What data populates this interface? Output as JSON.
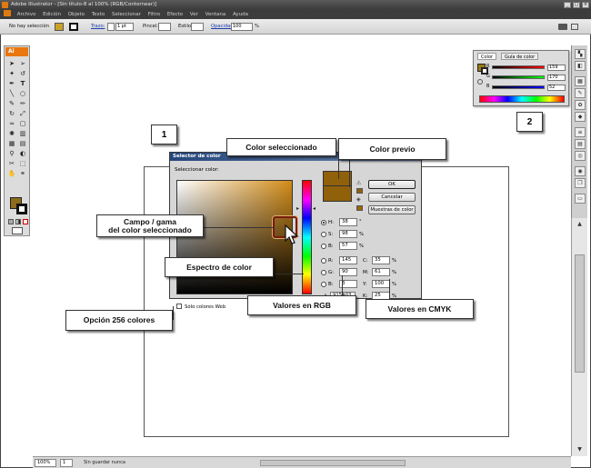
{
  "window": {
    "title": "Adobe Illustrator - [Sin título-8 al 100% (RGB/Contornear)]",
    "controls": [
      "_",
      "□",
      "×"
    ]
  },
  "menubar": {
    "items": [
      "Archivo",
      "Edición",
      "Objeto",
      "Texto",
      "Seleccionar",
      "Filtro",
      "Efecto",
      "Ver",
      "Ventana",
      "Ayuda"
    ]
  },
  "controlbar": {
    "selection": "No hay selección",
    "stroke_label": "Trazo:",
    "stroke_weight": "1 pt",
    "brush_label": "Pincel:",
    "style_label": "Estilo:",
    "opacity_label": "Opacidad:",
    "opacity_value": "100",
    "opacity_unit": "%"
  },
  "tools": {
    "badge": "Ai",
    "icons": [
      "selection-arrow-icon",
      "direct-select-icon",
      "magic-wand-icon",
      "lasso-icon",
      "pen-icon",
      "type-icon",
      "line-icon",
      "ellipse-icon",
      "paintbrush-icon",
      "pencil-icon",
      "rotate-icon",
      "scale-icon",
      "warp-icon",
      "free-transform-icon",
      "symbol-sprayer-icon",
      "graph-icon",
      "mesh-icon",
      "gradient-icon",
      "eyedropper-icon",
      "blend-icon",
      "scissors-icon",
      "artboard-icon",
      "hand-icon",
      "zoom-icon"
    ],
    "fill_color": "#8f6b1d"
  },
  "color_panel": {
    "tab_color": "Color",
    "tab_guide": "Guía de color",
    "channels": [
      {
        "label": "R",
        "value": "159"
      },
      {
        "label": "G",
        "value": "170"
      },
      {
        "label": "B",
        "value": "52"
      }
    ]
  },
  "picker": {
    "title": "Selector de color",
    "select_label": "Seleccionar color:",
    "ok": "OK",
    "cancel": "Cancelar",
    "swatches": "Muestras de color",
    "hsb": [
      {
        "label": "H:",
        "value": "38",
        "unit": "°"
      },
      {
        "label": "S:",
        "value": "98",
        "unit": "%"
      },
      {
        "label": "B:",
        "value": "57",
        "unit": "%"
      }
    ],
    "rgb": [
      {
        "label": "R:",
        "value": "145"
      },
      {
        "label": "G:",
        "value": "90"
      },
      {
        "label": "B:",
        "value": "3"
      }
    ],
    "cmyk": [
      {
        "label": "C:",
        "value": "35",
        "unit": "%"
      },
      {
        "label": "M:",
        "value": "61",
        "unit": "%"
      },
      {
        "label": "Y:",
        "value": "100",
        "unit": "%"
      },
      {
        "label": "K:",
        "value": "25",
        "unit": "%"
      }
    ],
    "hex_prefix": "#",
    "hex_value": "915A03",
    "web_only": "Sólo colores Web",
    "swatch_color": "#91600a"
  },
  "callouts": {
    "num1": "1",
    "num2": "2",
    "selected": "Color seleccionado",
    "previous": "Color previo",
    "field_line1": "Campo / gama",
    "field_line2": "del color seleccionado",
    "spectrum": "Espectro de color",
    "rgb": "Valores en RGB",
    "cmyk": "Valores en CMYK",
    "web256": "Opción 256 colores"
  },
  "statusbar": {
    "zoom": "100%",
    "page": "1",
    "status": "Sin guardar nunca"
  }
}
